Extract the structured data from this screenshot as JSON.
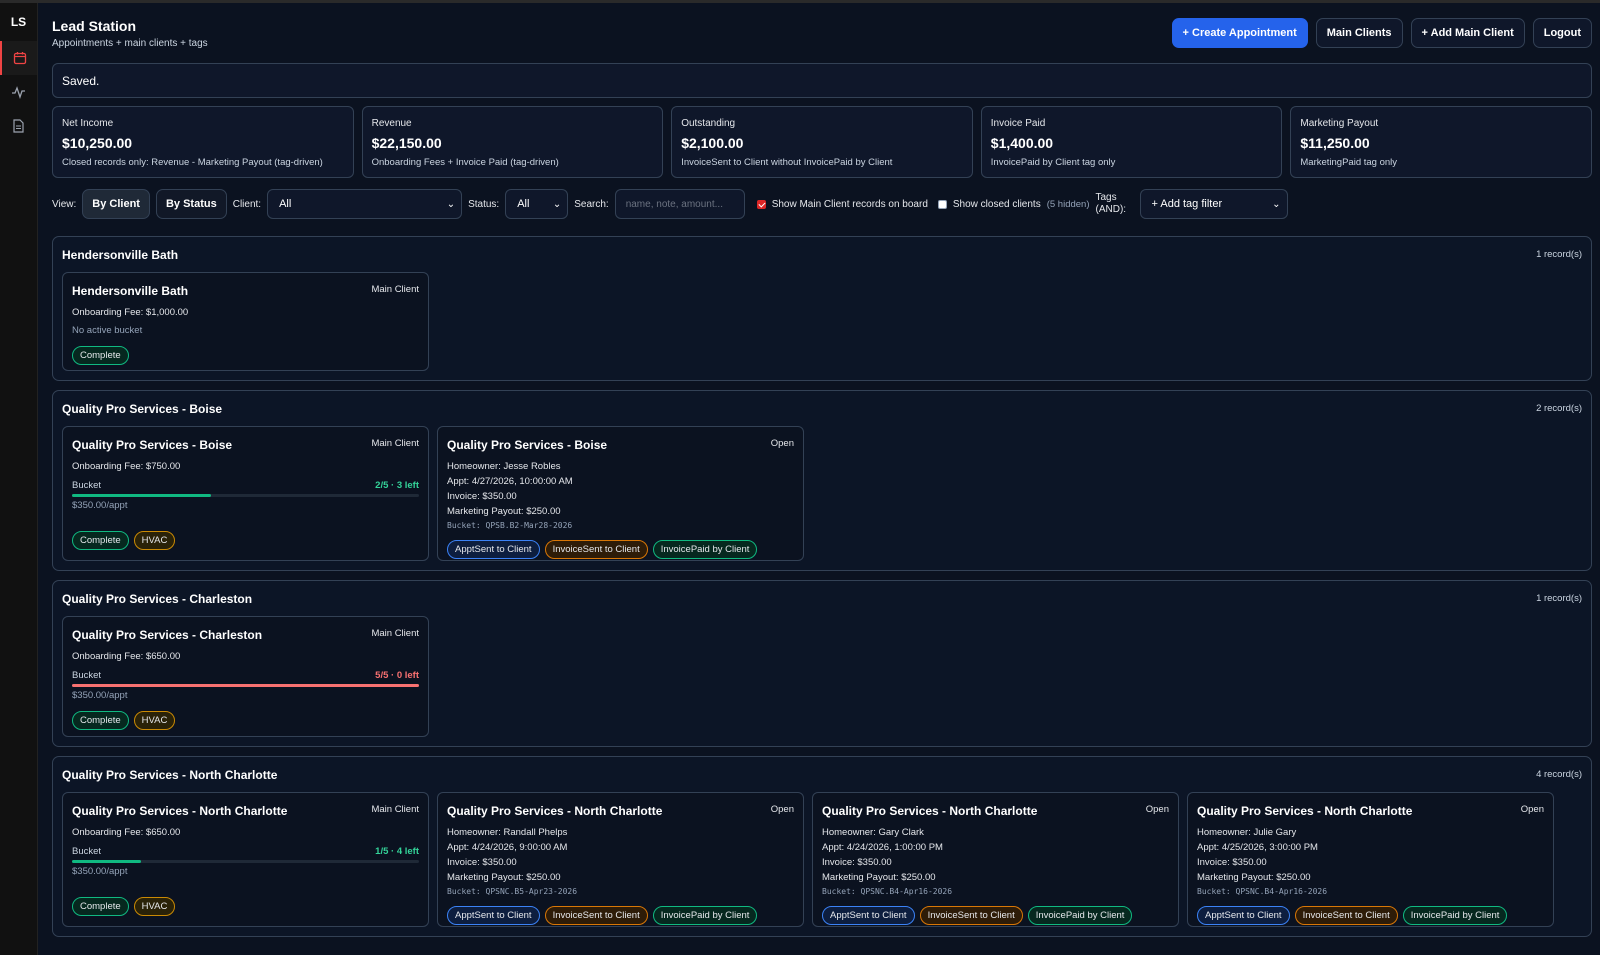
{
  "sidebar": {
    "logo": "LS",
    "nav": [
      "calendar-icon",
      "activity-icon",
      "document-icon"
    ]
  },
  "header": {
    "title": "Lead Station",
    "subtitle": "Appointments + main clients + tags",
    "buttons": {
      "create": "+ Create Appointment",
      "main_clients": "Main Clients",
      "add_main_client": "+ Add Main Client",
      "logout": "Logout"
    }
  },
  "message": "Saved.",
  "stats": [
    {
      "label": "Net Income",
      "value": "$10,250.00",
      "note": "Closed records only: Revenue - Marketing Payout (tag-driven)"
    },
    {
      "label": "Revenue",
      "value": "$22,150.00",
      "note": "Onboarding Fees + Invoice Paid (tag-driven)"
    },
    {
      "label": "Outstanding",
      "value": "$2,100.00",
      "note": "InvoiceSent to Client without InvoicePaid by Client"
    },
    {
      "label": "Invoice Paid",
      "value": "$1,400.00",
      "note": "InvoicePaid by Client tag only"
    },
    {
      "label": "Marketing Payout",
      "value": "$11,250.00",
      "note": "MarketingPaid tag only"
    }
  ],
  "filters": {
    "view_label": "View:",
    "by_client": "By Client",
    "by_status": "By Status",
    "client_label": "Client:",
    "client_value": "All",
    "status_label": "Status:",
    "status_value": "All",
    "search_label": "Search:",
    "search_placeholder": "name, note, amount...",
    "show_main": "Show Main Client records on board",
    "show_closed": "Show closed clients",
    "hidden_count": "(5 hidden)",
    "tags_label": "Tags (AND):",
    "tag_filter": "+ Add tag filter"
  },
  "groups": [
    {
      "name": "Hendersonville Bath",
      "count": "1 record(s)",
      "main": {
        "title": "Hendersonville Bath",
        "type": "Main Client",
        "fee": "Onboarding Fee: $1,000.00",
        "no_bucket": "No active bucket",
        "tags": [
          "Complete"
        ]
      },
      "records": []
    },
    {
      "name": "Quality Pro Services - Boise",
      "count": "2 record(s)",
      "main": {
        "title": "Quality Pro Services - Boise",
        "type": "Main Client",
        "fee": "Onboarding Fee: $750.00",
        "bucket_label": "Bucket",
        "bucket_count": "2/5 · 3 left",
        "bucket_fraction": 0.4,
        "rate": "$350.00/appt",
        "tags": [
          "Complete",
          "HVAC"
        ]
      },
      "records": [
        {
          "title": "Quality Pro Services - Boise",
          "type": "Open",
          "homeowner": "Homeowner: Jesse Robles",
          "appt": "Appt: 4/27/2026, 10:00:00 AM",
          "invoice": "Invoice: $350.00",
          "payout": "Marketing Payout: $250.00",
          "bucket": "Bucket: QPSB.B2-Mar28-2026",
          "tags": [
            "ApptSent to Client",
            "InvoiceSent to Client",
            "InvoicePaid by Client"
          ]
        }
      ]
    },
    {
      "name": "Quality Pro Services - Charleston",
      "count": "1 record(s)",
      "main": {
        "title": "Quality Pro Services - Charleston",
        "type": "Main Client",
        "fee": "Onboarding Fee: $650.00",
        "bucket_label": "Bucket",
        "bucket_count": "5/5 · 0 left",
        "bucket_fraction": 1.0,
        "rate": "$350.00/appt",
        "tags": [
          "Complete",
          "HVAC"
        ]
      },
      "records": []
    },
    {
      "name": "Quality Pro Services - North Charlotte",
      "count": "4 record(s)",
      "main": {
        "title": "Quality Pro Services - North Charlotte",
        "type": "Main Client",
        "fee": "Onboarding Fee: $650.00",
        "bucket_label": "Bucket",
        "bucket_count": "1/5 · 4 left",
        "bucket_fraction": 0.2,
        "rate": "$350.00/appt",
        "tags": [
          "Complete",
          "HVAC"
        ]
      },
      "records": [
        {
          "title": "Quality Pro Services - North Charlotte",
          "type": "Open",
          "homeowner": "Homeowner: Randall Phelps",
          "appt": "Appt: 4/24/2026, 9:00:00 AM",
          "invoice": "Invoice: $350.00",
          "payout": "Marketing Payout: $250.00",
          "bucket": "Bucket: QPSNC.B5-Apr23-2026",
          "tags": [
            "ApptSent to Client",
            "InvoiceSent to Client",
            "InvoicePaid by Client"
          ]
        },
        {
          "title": "Quality Pro Services - North Charlotte",
          "type": "Open",
          "homeowner": "Homeowner: Gary Clark",
          "appt": "Appt: 4/24/2026, 1:00:00 PM",
          "invoice": "Invoice: $350.00",
          "payout": "Marketing Payout: $250.00",
          "bucket": "Bucket: QPSNC.B4-Apr16-2026",
          "tags": [
            "ApptSent to Client",
            "InvoiceSent to Client",
            "InvoicePaid by Client"
          ]
        },
        {
          "title": "Quality Pro Services - North Charlotte",
          "type": "Open",
          "homeowner": "Homeowner: Julie Gary",
          "appt": "Appt: 4/25/2026, 3:00:00 PM",
          "invoice": "Invoice: $350.00",
          "payout": "Marketing Payout: $250.00",
          "bucket": "Bucket: QPSNC.B4-Apr16-2026",
          "tags": [
            "ApptSent to Client",
            "InvoiceSent to Client",
            "InvoicePaid by Client"
          ]
        }
      ]
    }
  ]
}
